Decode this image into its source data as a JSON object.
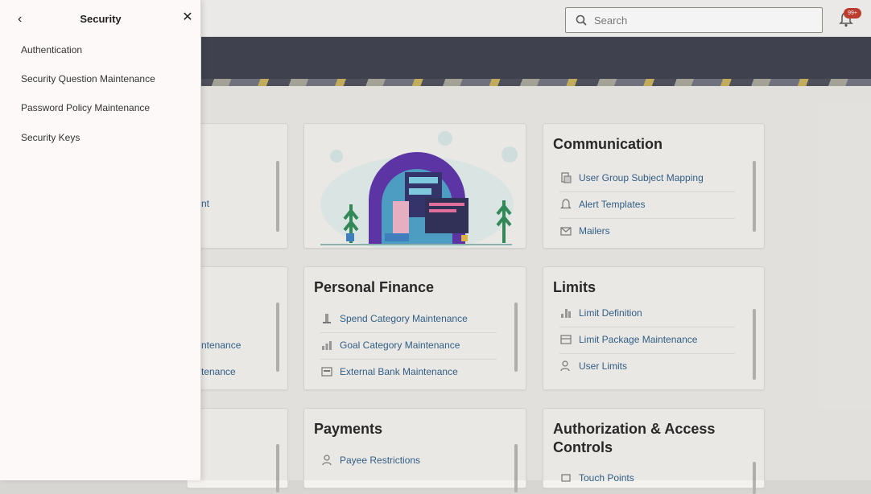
{
  "topbar": {
    "search_placeholder": "Search",
    "notification_badge": "99+"
  },
  "panel": {
    "title": "Security",
    "back_glyph": "‹",
    "close_glyph": "✕",
    "items": [
      {
        "label": "Authentication"
      },
      {
        "label": "Security Question Maintenance"
      },
      {
        "label": "Password Policy Maintenance"
      },
      {
        "label": "Security Keys"
      }
    ]
  },
  "cards": {
    "partial_text": {
      "line1": "nt",
      "line2": "ntenance",
      "line3": "tenance"
    },
    "communication": {
      "title": "Communication",
      "items": [
        {
          "label": "User Group Subject Mapping",
          "icon": "mapping-icon"
        },
        {
          "label": "Alert Templates",
          "icon": "bell-icon"
        },
        {
          "label": "Mailers",
          "icon": "mail-icon"
        }
      ]
    },
    "personal_finance": {
      "title": "Personal Finance",
      "items": [
        {
          "label": "Spend Category Maintenance",
          "icon": "spend-icon"
        },
        {
          "label": "Goal Category Maintenance",
          "icon": "goal-icon"
        },
        {
          "label": "External Bank Maintenance",
          "icon": "bank-icon"
        }
      ]
    },
    "limits": {
      "title": "Limits",
      "items": [
        {
          "label": "Limit Definition",
          "icon": "limit-icon"
        },
        {
          "label": "Limit Package Maintenance",
          "icon": "package-icon"
        },
        {
          "label": "User Limits",
          "icon": "user-limit-icon"
        }
      ]
    },
    "payments": {
      "title": "Payments",
      "items": [
        {
          "label": "Payee Restrictions",
          "icon": "payee-icon"
        }
      ]
    },
    "authorization": {
      "title": "Authorization & Access Controls",
      "items": [
        {
          "label": "Touch Points",
          "icon": "touch-icon"
        }
      ]
    }
  },
  "colors": {
    "link": "#2c5d87",
    "banner": "#3b3d4d",
    "badge": "#c0392b"
  }
}
